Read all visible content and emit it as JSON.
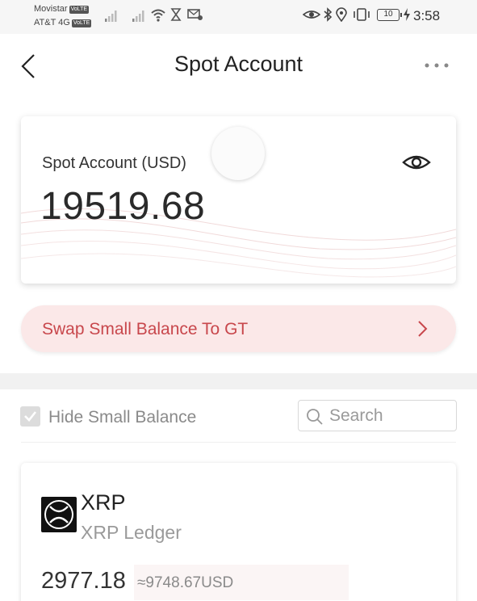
{
  "status_bar": {
    "carrier_1": "Movistar",
    "carrier_2": "AT&T 4G",
    "volte_badge": "VoLTE",
    "battery": "10",
    "time": "3:58"
  },
  "nav": {
    "title": "Spot Account",
    "back_icon": "chevron-left-icon",
    "more_icon": "more-horizontal-icon"
  },
  "account": {
    "label": "Spot Account (USD)",
    "balance": "19519.68",
    "visibility_icon": "eye-icon"
  },
  "swap": {
    "label": "Swap Small Balance To GT",
    "icon": "chevron-right-icon"
  },
  "filters": {
    "hide_small_label": "Hide Small Balance",
    "hide_small_checked": true,
    "search_placeholder": "Search",
    "search_value": ""
  },
  "coins": [
    {
      "symbol": "XRP",
      "name": "XRP Ledger",
      "amount": "2977.18",
      "value": "≈9748.67USD",
      "logo_icon": "xrp-logo-icon"
    }
  ],
  "colors": {
    "accent": "#c8474c",
    "swap_bg": "#fbe8e8",
    "divider_band": "#f1f1f1"
  }
}
